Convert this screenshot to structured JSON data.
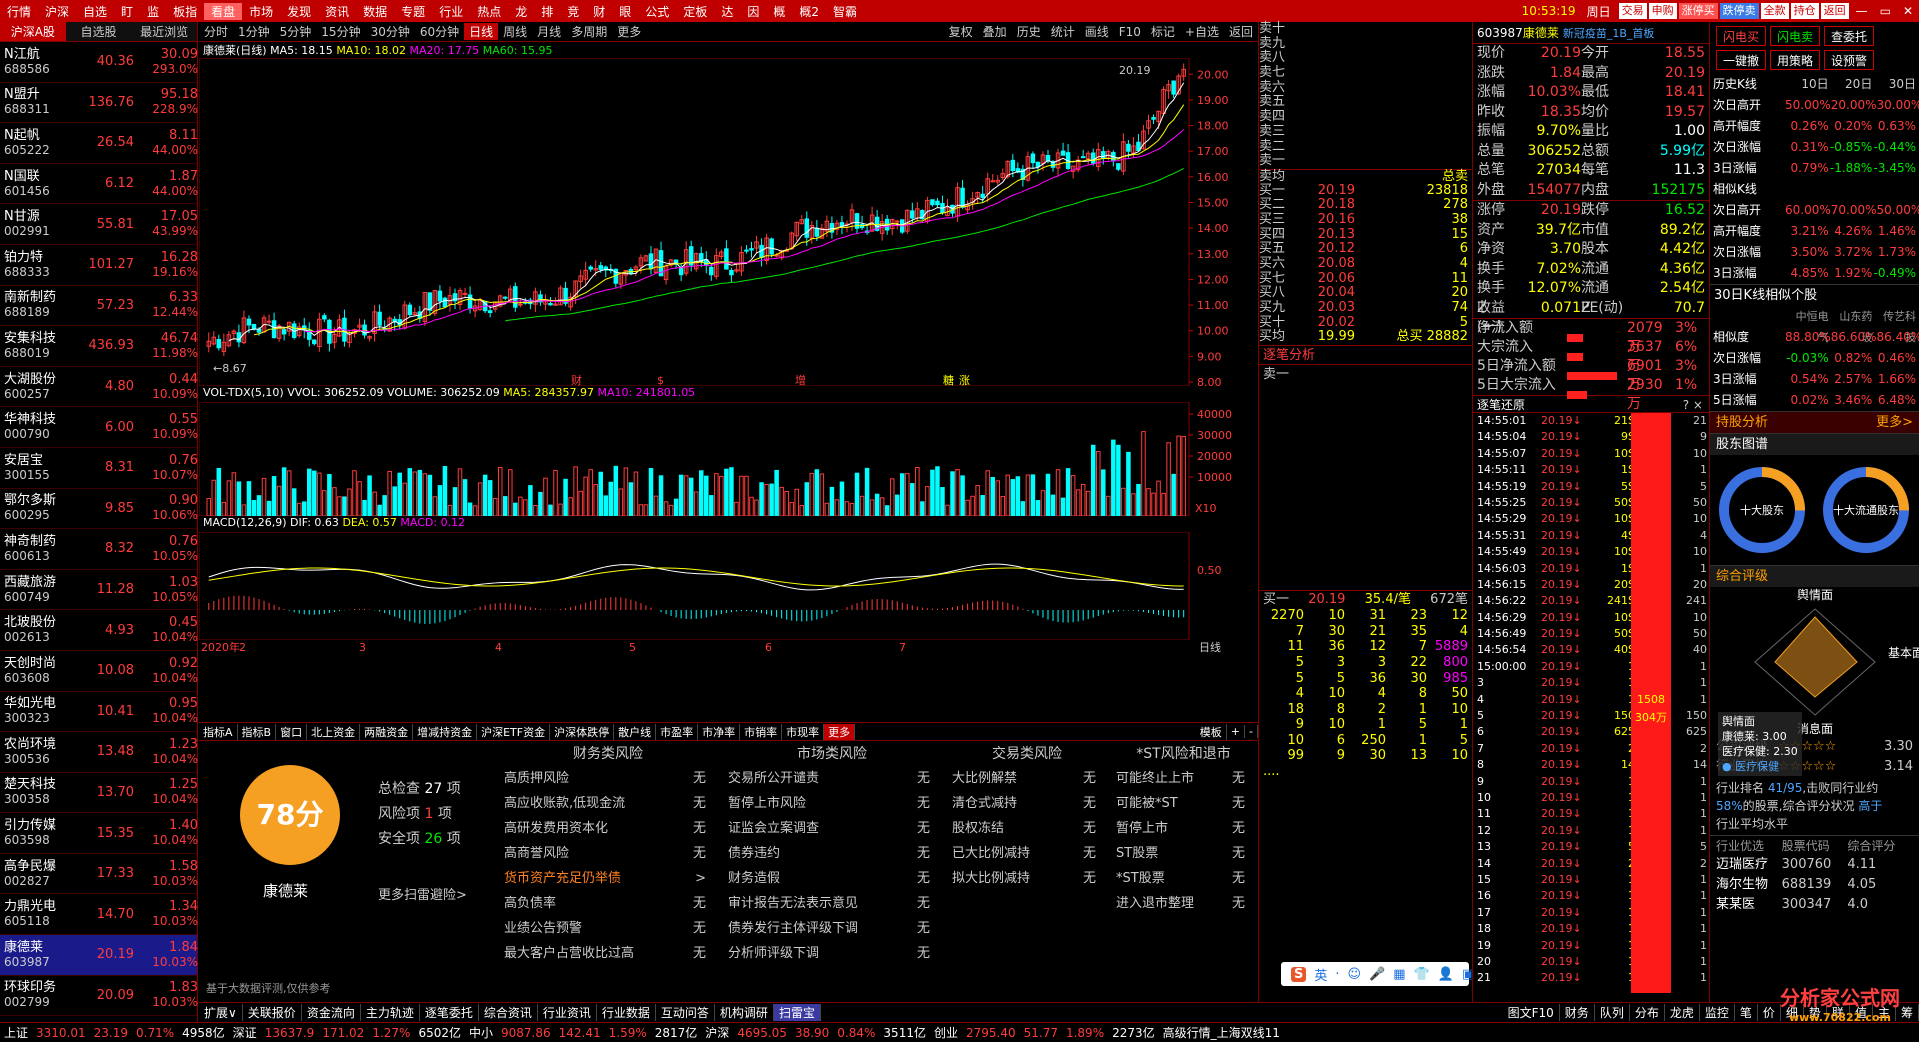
{
  "menu": [
    "行情",
    "沪深",
    "自选",
    "盯",
    "监",
    "板指",
    "看盘",
    "市场",
    "发现",
    "资讯",
    "数据",
    "专题",
    "行业",
    "热点",
    "龙",
    "排",
    "竞",
    "财",
    "眼",
    "公式",
    "定板",
    "达",
    "因",
    "概",
    "概2",
    "智霸"
  ],
  "menu_highlight": "看盘",
  "clock": "10:53:19",
  "weekday": "周日",
  "top_tools": [
    "交易",
    "申购",
    "涨停买",
    "跌停卖",
    "全款",
    "持仓",
    "返回"
  ],
  "left": {
    "tabs": [
      "沪深A股",
      "自选股",
      "最近浏览"
    ],
    "stocks": [
      {
        "name": "N江航",
        "code": "688586",
        "price": "40.36",
        "chg": "30.09",
        "pct": "293.0%"
      },
      {
        "name": "N盟升",
        "code": "688311",
        "price": "136.76",
        "chg": "95.18",
        "pct": "228.9%"
      },
      {
        "name": "N起帆",
        "code": "605222",
        "price": "26.54",
        "chg": "8.11",
        "pct": "44.00%"
      },
      {
        "name": "N国联",
        "code": "601456",
        "price": "6.12",
        "chg": "1.87",
        "pct": "44.00%"
      },
      {
        "name": "N甘源",
        "code": "002991",
        "price": "55.81",
        "chg": "17.05",
        "pct": "43.99%"
      },
      {
        "name": "铂力特",
        "code": "688333",
        "price": "101.27",
        "chg": "16.28",
        "pct": "19.16%"
      },
      {
        "name": "南新制药",
        "code": "688189",
        "price": "57.23",
        "chg": "6.33",
        "pct": "12.44%"
      },
      {
        "name": "安集科技",
        "code": "688019",
        "price": "436.93",
        "chg": "46.74",
        "pct": "11.98%"
      },
      {
        "name": "大湖股份",
        "code": "600257",
        "price": "4.80",
        "chg": "0.44",
        "pct": "10.09%"
      },
      {
        "name": "华神科技",
        "code": "000790",
        "price": "6.00",
        "chg": "0.55",
        "pct": "10.09%"
      },
      {
        "name": "安居宝",
        "code": "300155",
        "price": "8.31",
        "chg": "0.76",
        "pct": "10.07%"
      },
      {
        "name": "鄂尔多斯",
        "code": "600295",
        "price": "9.85",
        "chg": "0.90",
        "pct": "10.06%"
      },
      {
        "name": "神奇制药",
        "code": "600613",
        "price": "8.32",
        "chg": "0.76",
        "pct": "10.05%"
      },
      {
        "name": "西藏旅游",
        "code": "600749",
        "price": "11.28",
        "chg": "1.03",
        "pct": "10.05%"
      },
      {
        "name": "北玻股份",
        "code": "002613",
        "price": "4.93",
        "chg": "0.45",
        "pct": "10.04%"
      },
      {
        "name": "天创时尚",
        "code": "603608",
        "price": "10.08",
        "chg": "0.92",
        "pct": "10.04%"
      },
      {
        "name": "华如光电",
        "code": "300323",
        "price": "10.41",
        "chg": "0.95",
        "pct": "10.04%"
      },
      {
        "name": "农尚环境",
        "code": "300536",
        "price": "13.48",
        "chg": "1.23",
        "pct": "10.04%"
      },
      {
        "name": "楚天科技",
        "code": "300358",
        "price": "13.70",
        "chg": "1.25",
        "pct": "10.04%"
      },
      {
        "name": "引力传媒",
        "code": "603598",
        "price": "15.35",
        "chg": "1.40",
        "pct": "10.04%"
      },
      {
        "name": "高争民爆",
        "code": "002827",
        "price": "17.33",
        "chg": "1.58",
        "pct": "10.03%"
      },
      {
        "name": "力鼎光电",
        "code": "605118",
        "price": "14.70",
        "chg": "1.34",
        "pct": "10.03%"
      },
      {
        "name": "康德莱",
        "code": "603987",
        "price": "20.19",
        "chg": "1.84",
        "pct": "10.03%"
      },
      {
        "name": "环球印务",
        "code": "002799",
        "price": "20.09",
        "chg": "1.83",
        "pct": "10.03%"
      }
    ]
  },
  "chart": {
    "periods": [
      "分时",
      "1分钟",
      "5分钟",
      "15分钟",
      "30分钟",
      "60分钟",
      "日线",
      "周线",
      "月线",
      "多周期",
      "更多"
    ],
    "active_period": "日线",
    "tools": [
      "复权",
      "叠加",
      "历史",
      "统计",
      "画线",
      "F10",
      "标记",
      "+自选",
      "返回"
    ],
    "ma_title": "康德莱(日线)",
    "ma5": "MA5: 18.15",
    "ma10": "MA10: 18.02",
    "ma20": "MA20: 17.75",
    "ma60": "MA60: 15.95",
    "price_axis": [
      "20.00",
      "19.00",
      "18.00",
      "17.00",
      "16.00",
      "15.00",
      "14.00",
      "13.00",
      "12.00",
      "11.00",
      "10.00",
      "9.00",
      "8.00"
    ],
    "high_label": "20.19",
    "low_label": "8.67",
    "events": [
      "财",
      "$",
      "增",
      "糖",
      "涨"
    ],
    "vol_title": "VOL-TDX(5,10)",
    "vvol": "VVOL: 306252.09",
    "volume": "VOLUME: 306252.09",
    "vol_ma5": "MA5: 284357.97",
    "vol_ma10": "MA10: 241801.05",
    "vol_axis": [
      "40000",
      "30000",
      "20000",
      "10000"
    ],
    "vol_unit": "X10",
    "macd_title": "MACD(12,26,9)",
    "dif": "DIF: 0.63",
    "dea": "DEA: 0.57",
    "macd": "MACD: 0.12",
    "macd_axis": "0.50",
    "date_axis": [
      "2020年",
      "2",
      "3",
      "4",
      "5",
      "6",
      "7"
    ],
    "period_label": "日线"
  },
  "panel_tabs": [
    "指标A",
    "指标B",
    "窗口",
    "北上资金",
    "两融资金",
    "增减持资金",
    "沪深ETF资金",
    "沪深体跌停",
    "散户线",
    "市盈率",
    "市净率",
    "市销率",
    "市现率",
    "更多"
  ],
  "panel_right": [
    "模板",
    "+",
    "-"
  ],
  "risk": {
    "score": "78分",
    "stock": "康德莱",
    "total_label": "总检查",
    "total": "27",
    "total_unit": "项",
    "risk_label": "风险项",
    "risk_count": "1",
    "risk_unit": "项",
    "safe_label": "安全项",
    "safe": "26",
    "safe_unit": "项",
    "more": "更多扫雷避险>",
    "note": "基于大数据评测,仅供参考",
    "cols": [
      {
        "title": "财务类风险",
        "items": [
          [
            "高质押风险",
            "无"
          ],
          [
            "高应收账款,低现金流",
            "无"
          ],
          [
            "高研发费用资本化",
            "无"
          ],
          [
            "高商誉风险",
            "无"
          ],
          [
            "货币资产充足仍举债",
            ">"
          ],
          [
            "高负债率",
            "无"
          ],
          [
            "业绩公告预警",
            "无"
          ],
          [
            "最大客户占营收比过高",
            "无"
          ]
        ]
      },
      {
        "title": "市场类风险",
        "items": [
          [
            "交易所公开谴责",
            "无"
          ],
          [
            "暂停上市风险",
            "无"
          ],
          [
            "证监会立案调查",
            "无"
          ],
          [
            "债券违约",
            "无"
          ],
          [
            "财务造假",
            "无"
          ],
          [
            "审计报告无法表示意见",
            "无"
          ],
          [
            "债券发行主体评级下调",
            "无"
          ],
          [
            "分析师评级下调",
            "无"
          ]
        ]
      },
      {
        "title": "交易类风险",
        "items": [
          [
            "大比例解禁",
            "无"
          ],
          [
            "清仓式减持",
            "无"
          ],
          [
            "股权冻结",
            "无"
          ],
          [
            "已大比例减持",
            "无"
          ],
          [
            "拟大比例减持",
            "无"
          ]
        ]
      },
      {
        "title": "*ST风险和退市",
        "items": [
          [
            "可能终止上市",
            "无"
          ],
          [
            "可能被*ST",
            "无"
          ],
          [
            "暂停上市",
            "无"
          ],
          [
            "ST股票",
            "无"
          ],
          [
            "*ST股票",
            "无"
          ],
          [
            "进入退市整理",
            "无"
          ]
        ]
      }
    ]
  },
  "orderbook": {
    "sells": [
      "卖十",
      "卖九",
      "卖八",
      "卖七",
      "卖六",
      "卖五",
      "卖四",
      "卖三",
      "卖二",
      "卖一"
    ],
    "buys": [
      {
        "l": "买一",
        "p": "20.19",
        "v": "23818"
      },
      {
        "l": "买二",
        "p": "20.18",
        "v": "278"
      },
      {
        "l": "买三",
        "p": "20.16",
        "v": "38"
      },
      {
        "l": "买四",
        "p": "20.13",
        "v": "15"
      },
      {
        "l": "买五",
        "p": "20.12",
        "v": "6"
      },
      {
        "l": "买六",
        "p": "20.08",
        "v": "4"
      },
      {
        "l": "买七",
        "p": "20.06",
        "v": "11"
      },
      {
        "l": "买八",
        "p": "20.04",
        "v": "20"
      },
      {
        "l": "买九",
        "p": "20.03",
        "v": "74"
      },
      {
        "l": "买十",
        "p": "20.02",
        "v": "5"
      }
    ],
    "avg_sell_label": "卖均",
    "total_sell_label": "总卖",
    "avg_buy_label": "买均",
    "avg_buy": "19.99",
    "total_buy_label": "总买",
    "total_buy": "28882",
    "analysis": "逐笔分析",
    "sell1": "卖一",
    "buy1_label": "买一",
    "buy1_price": "20.19",
    "buy1_avg": "35.4/笔",
    "buy1_count": "672笔",
    "queue": [
      [
        "2270",
        "10",
        "31",
        "23",
        "12"
      ],
      [
        "7",
        "30",
        "21",
        "35",
        "4"
      ],
      [
        "11",
        "36",
        "12",
        "7",
        "5889"
      ],
      [
        "5",
        "3",
        "3",
        "22",
        "800"
      ],
      [
        "5",
        "5",
        "36",
        "30",
        "985"
      ],
      [
        "4",
        "10",
        "4",
        "8",
        "50"
      ],
      [
        "18",
        "8",
        "2",
        "1",
        "10"
      ],
      [
        "9",
        "10",
        "1",
        "5",
        "1"
      ],
      [
        "10",
        "6",
        "250",
        "1",
        "5"
      ],
      [
        "99",
        "9",
        "30",
        "13",
        "10"
      ],
      [
        "....",
        "",
        "",
        "",
        ""
      ]
    ]
  },
  "quote": {
    "code": "603987",
    "name": "康德莱",
    "tag": "新冠疫苗_1B_首板",
    "rows": [
      [
        "现价",
        "20.19",
        "今开",
        "18.55"
      ],
      [
        "涨跌",
        "1.84",
        "最高",
        "20.19"
      ],
      [
        "涨幅",
        "10.03%",
        "最低",
        "18.41"
      ],
      [
        "昨收",
        "18.35",
        "均价",
        "19.57"
      ],
      [
        "振幅",
        "9.70%",
        "量比",
        "1.00"
      ],
      [
        "总量",
        "306252",
        "总额",
        "5.99亿"
      ],
      [
        "总笔",
        "27034",
        "每笔",
        "11.3"
      ],
      [
        "外盘",
        "154077",
        "内盘",
        "152175"
      ]
    ],
    "rows2": [
      [
        "涨停",
        "20.19",
        "跌停",
        "16.52"
      ],
      [
        "资产",
        "39.7亿",
        "市值",
        "89.2亿"
      ],
      [
        "净资",
        "3.70",
        "股本",
        "4.42亿"
      ],
      [
        "换手",
        "7.02%",
        "流通",
        "4.36亿"
      ],
      [
        "换手Z",
        "12.07%",
        "流通Z",
        "2.54亿"
      ],
      [
        "收益(一)",
        "0.071",
        "PE(动)",
        "70.7"
      ]
    ],
    "funds": [
      [
        "净流入额",
        "2079万",
        "3%"
      ],
      [
        "大宗流入",
        "3637万",
        "6%"
      ],
      [
        "5日净流入额",
        "6901万",
        "3%"
      ],
      [
        "5日大宗流入",
        "2930万",
        "1%"
      ]
    ],
    "tick_title": "逐笔还原",
    "ticks": [
      [
        "14:55:01",
        "20.19",
        "21S"
      ],
      [
        "14:55:04",
        "20.19",
        "9S"
      ],
      [
        "14:55:07",
        "20.19",
        "10S"
      ],
      [
        "14:55:11",
        "20.19",
        "1S"
      ],
      [
        "14:55:19",
        "20.19",
        "5S"
      ],
      [
        "14:55:25",
        "20.19",
        "50S"
      ],
      [
        "14:55:29",
        "20.19",
        "10S"
      ],
      [
        "14:55:31",
        "20.19",
        "4S"
      ],
      [
        "14:55:49",
        "20.19",
        "10S"
      ],
      [
        "14:56:03",
        "20.19",
        "1S"
      ],
      [
        "14:56:15",
        "20.19",
        "20S"
      ],
      [
        "14:56:22",
        "20.19",
        "241S"
      ],
      [
        "14:56:29",
        "20.19",
        "10S"
      ],
      [
        "14:56:49",
        "20.19",
        "50S"
      ],
      [
        "14:56:54",
        "20.19",
        "40S"
      ],
      [
        "15:00:00",
        "20.19",
        "1"
      ],
      [
        "3",
        "20.19",
        "1"
      ],
      [
        "4",
        "20.19",
        "1"
      ],
      [
        "5",
        "20.19",
        "150"
      ],
      [
        "6",
        "20.19",
        "625"
      ],
      [
        "7",
        "20.19",
        "2"
      ],
      [
        "8",
        "20.19",
        "14"
      ],
      [
        "9",
        "20.19",
        "1"
      ],
      [
        "10",
        "20.19",
        "1"
      ],
      [
        "11",
        "20.19",
        "1"
      ],
      [
        "12",
        "20.19",
        "1"
      ],
      [
        "13",
        "20.19",
        "5"
      ],
      [
        "14",
        "20.19",
        "2"
      ],
      [
        "15",
        "20.19",
        "1"
      ],
      [
        "16",
        "20.19",
        "1"
      ],
      [
        "17",
        "20.19",
        "1"
      ],
      [
        "18",
        "20.19",
        "1"
      ],
      [
        "19",
        "20.19",
        "1"
      ],
      [
        "20",
        "20.19",
        "1"
      ],
      [
        "21",
        "20.19",
        "1"
      ]
    ],
    "tick_bar_label": "1508",
    "tick_bar_label2": "304万",
    "tick_axis": [
      "21",
      "9",
      "10",
      "1",
      "5",
      "50",
      "10",
      "4",
      "10",
      "1",
      "20",
      "241",
      "10",
      "50",
      "40",
      "1",
      "1",
      "1",
      "150",
      "625",
      "2",
      "14",
      "1",
      "1",
      "1",
      "1",
      "5",
      "2",
      "1",
      "1",
      "1",
      "1",
      "1",
      "1",
      "1"
    ]
  },
  "right": {
    "buttons": [
      "闪电买",
      "闪电卖",
      "查委托",
      "一键撤",
      "用策略",
      "设预警"
    ],
    "hist_title": "历史K线",
    "hist_head": [
      "",
      "10日",
      "20日",
      "30日"
    ],
    "hist": [
      [
        "次日高开",
        "50.00%",
        "20.00%",
        "30.00%"
      ],
      [
        "高开幅度",
        "0.26%",
        "0.20%",
        "0.63%"
      ],
      [
        "次日涨幅",
        "0.31%",
        "-0.85%",
        "-0.44%"
      ],
      [
        "3日涨幅",
        "0.79%",
        "-1.88%",
        "-3.45%"
      ]
    ],
    "sim_title": "相似K线",
    "sim": [
      [
        "次日高开",
        "60.00%",
        "70.00%",
        "50.00%"
      ],
      [
        "高开幅度",
        "3.21%",
        "4.26%",
        "1.46%"
      ],
      [
        "次日涨幅",
        "3.50%",
        "3.72%",
        "1.73%"
      ],
      [
        "3日涨幅",
        "4.85%",
        "1.92%",
        "-0.49%"
      ]
    ],
    "sim30_title": "30日K线相似个股",
    "sim30_head": [
      "",
      "中恒电气",
      "山东药玻",
      "传艺科技"
    ],
    "sim30": [
      [
        "相似度",
        "88.80%",
        "86.60%",
        "86.40%"
      ],
      [
        "次日涨幅",
        "-0.03%",
        "0.82%",
        "0.46%"
      ],
      [
        "3日涨幅",
        "0.54%",
        "2.57%",
        "1.66%"
      ],
      [
        "5日涨幅",
        "0.02%",
        "3.46%",
        "6.48%"
      ]
    ],
    "hold": "持股分析",
    "hold_more": "更多>",
    "share": "股东图谱",
    "donut1": "十大股东",
    "donut2": "十大流通股东",
    "rating": "综合评级",
    "radar_top": "舆情面",
    "radar_right": "基本面",
    "radar_bottom": "消息面",
    "radar_legend1": "舆情面",
    "radar_legend2": "康德莱:",
    "radar_legend2v": "3.00",
    "radar_legend3": "医疗保健:",
    "radar_legend3v": "2.30",
    "radar_legend4": "医疗保健",
    "co_label": "公司评级",
    "co_val": "3.30",
    "ind_label": "行业平均",
    "ind_val": "3.14",
    "rank_text1": "行业排名",
    "rank_val": "41/95",
    "rank_text2": ",击败同行业约",
    "rank_pct": "58%",
    "rank_text3": "的股票,综合评分状况",
    "rank_hl": "高于",
    "rank_text4": "行业平均水平",
    "best_head": [
      "行业优选",
      "股票代码",
      "综合评分"
    ],
    "best": [
      [
        "迈瑞医疗",
        "300760",
        "4.11"
      ],
      [
        "海尔生物",
        "688139",
        "4.05"
      ],
      [
        "某某医",
        "300347",
        "4.0"
      ]
    ]
  },
  "bottom_tabs": [
    "扩展∨",
    "关联报价",
    "资金流向",
    "主力轨迹",
    "逐笔委托",
    "综合资讯",
    "行业资讯",
    "行业数据",
    "互动问答",
    "机构调研",
    "扫雷宝"
  ],
  "bottom_right": [
    "图文F10",
    "财务",
    "队列",
    "分布",
    "龙虎",
    "监控",
    "笔",
    "价",
    "细",
    "势",
    "联",
    "值",
    "主",
    "筹"
  ],
  "status": [
    {
      "t": "上证",
      "c": "wht"
    },
    {
      "t": "3310.01",
      "c": "red"
    },
    {
      "t": "23.19",
      "c": "red"
    },
    {
      "t": "0.71%",
      "c": "red"
    },
    {
      "t": "4958亿",
      "c": "wht"
    },
    {
      "t": "深证",
      "c": "wht"
    },
    {
      "t": "13637.9",
      "c": "red"
    },
    {
      "t": "171.02",
      "c": "red"
    },
    {
      "t": "1.27%",
      "c": "red"
    },
    {
      "t": "6502亿",
      "c": "wht"
    },
    {
      "t": "中小",
      "c": "wht"
    },
    {
      "t": "9087.86",
      "c": "red"
    },
    {
      "t": "142.41",
      "c": "red"
    },
    {
      "t": "1.59%",
      "c": "red"
    },
    {
      "t": "2817亿",
      "c": "wht"
    },
    {
      "t": "沪深",
      "c": "wht"
    },
    {
      "t": "4695.05",
      "c": "red"
    },
    {
      "t": "38.90",
      "c": "red"
    },
    {
      "t": "0.84%",
      "c": "red"
    },
    {
      "t": "3511亿",
      "c": "wht"
    },
    {
      "t": "创业",
      "c": "wht"
    },
    {
      "t": "2795.40",
      "c": "red"
    },
    {
      "t": "51.77",
      "c": "red"
    },
    {
      "t": "1.89%",
      "c": "red"
    },
    {
      "t": "2273亿",
      "c": "wht"
    },
    {
      "t": "高级行情_上海双线11",
      "c": "wht"
    }
  ],
  "watermark": "分析家公式网",
  "watermark2": "www.70822.com"
}
